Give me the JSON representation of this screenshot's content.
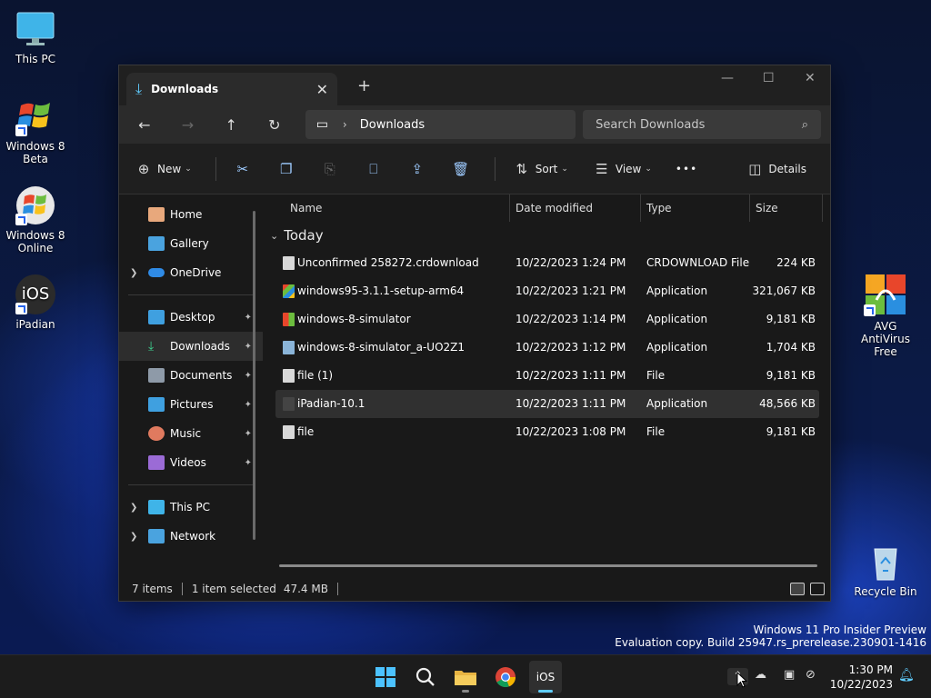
{
  "desktop": {
    "icons": [
      {
        "label": "This PC"
      },
      {
        "label": "Windows 8 Beta"
      },
      {
        "label": "Windows 8 Online"
      },
      {
        "label": "iPadian"
      },
      {
        "label": "AVG AntiVirus Free"
      },
      {
        "label": "Recycle Bin"
      }
    ],
    "ios_text": "iOS"
  },
  "window": {
    "tab_title": "Downloads",
    "new_tab": "+",
    "address_path": "Downloads",
    "search_placeholder": "Search Downloads",
    "toolbar": {
      "new_label": "New",
      "sort_label": "Sort",
      "view_label": "View",
      "more_label": "•••",
      "details_label": "Details"
    },
    "sidebar": {
      "home": "Home",
      "gallery": "Gallery",
      "onedrive": "OneDrive",
      "desktop": "Desktop",
      "downloads": "Downloads",
      "documents": "Documents",
      "pictures": "Pictures",
      "music": "Music",
      "videos": "Videos",
      "this_pc": "This PC",
      "network": "Network"
    },
    "columns": {
      "name": "Name",
      "date": "Date modified",
      "type": "Type",
      "size": "Size"
    },
    "group_label": "Today",
    "files": [
      {
        "name": "Unconfirmed 258272.crdownload",
        "date": "10/22/2023 1:24 PM",
        "type": "CRDOWNLOAD File",
        "size": "224 KB"
      },
      {
        "name": "windows95-3.1.1-setup-arm64",
        "date": "10/22/2023 1:21 PM",
        "type": "Application",
        "size": "321,067 KB"
      },
      {
        "name": "windows-8-simulator",
        "date": "10/22/2023 1:14 PM",
        "type": "Application",
        "size": "9,181 KB"
      },
      {
        "name": "windows-8-simulator_a-UO2Z1",
        "date": "10/22/2023 1:12 PM",
        "type": "Application",
        "size": "1,704 KB"
      },
      {
        "name": "file (1)",
        "date": "10/22/2023 1:11 PM",
        "type": "File",
        "size": "9,181 KB"
      },
      {
        "name": "iPadian-10.1",
        "date": "10/22/2023 1:11 PM",
        "type": "Application",
        "size": "48,566 KB"
      },
      {
        "name": "file",
        "date": "10/22/2023 1:08 PM",
        "type": "File",
        "size": "9,181 KB"
      }
    ],
    "status": {
      "items": "7 items",
      "selected": "1 item selected",
      "selected_size": "47.4 MB"
    }
  },
  "watermark": {
    "line1": "Windows 11 Pro Insider Preview",
    "line2": "Evaluation copy. Build 25947.rs_prerelease.230901-1416"
  },
  "taskbar": {
    "ios_label": "iOS",
    "time": "1:30 PM",
    "date": "10/22/2023"
  },
  "colors": {
    "accent": "#60cdff",
    "folder": "#e8b442",
    "selected_row": "#303030"
  }
}
